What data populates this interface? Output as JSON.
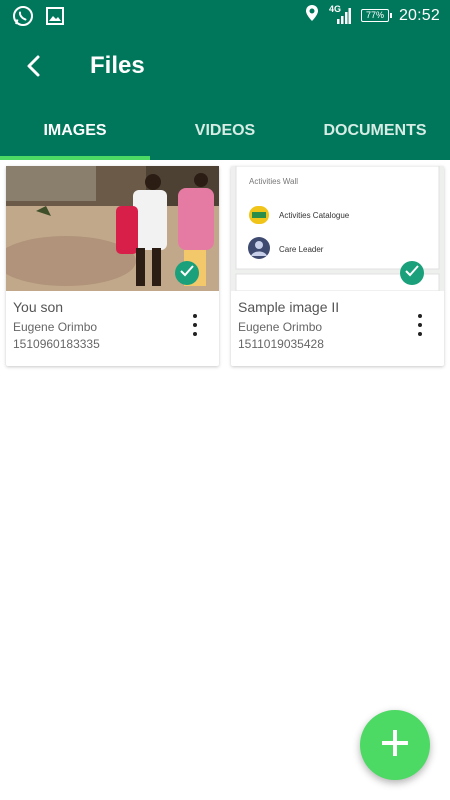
{
  "status_bar": {
    "network": "4G",
    "battery": "77%",
    "time": "20:52"
  },
  "app_bar": {
    "title": "Files"
  },
  "tabs": [
    {
      "label": "IMAGES",
      "active": true
    },
    {
      "label": "VIDEOS",
      "active": false
    },
    {
      "label": "DOCUMENTS",
      "active": false
    }
  ],
  "files": [
    {
      "name": "You son",
      "owner": "Eugene Orimbo",
      "stamp": "1510960183335",
      "selected": true
    },
    {
      "name": "Sample image II",
      "owner": "Eugene Orimbo",
      "stamp": "1511019035428",
      "selected": true
    }
  ],
  "preview_text": {
    "header": "Activities Wall",
    "row1": "Activities Catalogue",
    "row2": "Care Leader"
  },
  "colors": {
    "primary": "#00775b",
    "accent": "#4cd964",
    "check": "#1aa07a"
  },
  "icons": [
    "whatsapp-icon",
    "gallery-icon",
    "location-icon",
    "signal-icon",
    "battery-icon",
    "back-arrow-icon",
    "check-icon",
    "more-vert-icon",
    "plus-icon"
  ]
}
